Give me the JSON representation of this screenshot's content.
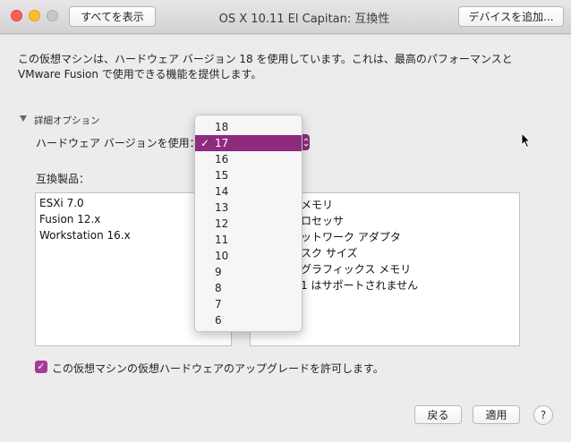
{
  "window": {
    "title": "OS X 10.11 El Capitan: 互換性",
    "show_all_label": "すべてを表示",
    "add_device_label": "デバイスを追加..."
  },
  "description": "この仮想マシンは、ハードウェア バージョン 18 を使用しています。これは、最高のパフォーマンスと VMware Fusion で使用できる機能を提供します。",
  "advanced": {
    "label": "詳細オプション",
    "hw_version_label": "ハードウェア バージョンを使用："
  },
  "compat": {
    "label": "互換製品：",
    "products": [
      "ESXi 7.0",
      "Fusion 12.x",
      "Workstation 16.x"
    ],
    "limits_visible": [
      "メモリ",
      "ロセッサ",
      "ットワーク アダプタ",
      "スク サイズ",
      "グラフィックス メモリ",
      "1 はサポートされません"
    ]
  },
  "dropdown": {
    "selected": "17",
    "check_glyph": "✓",
    "options": [
      "18",
      "17",
      "16",
      "15",
      "14",
      "13",
      "12",
      "11",
      "10",
      "9",
      "8",
      "7",
      "6"
    ]
  },
  "upgrade_checkbox": {
    "checked": true,
    "label": "この仮想マシンの仮想ハードウェアのアップグレードを許可します。"
  },
  "footer": {
    "revert_label": "戻る",
    "apply_label": "適用",
    "help_label": "?"
  },
  "colors": {
    "accent": "#8e2b7e",
    "checkbox": "#a43c96"
  }
}
